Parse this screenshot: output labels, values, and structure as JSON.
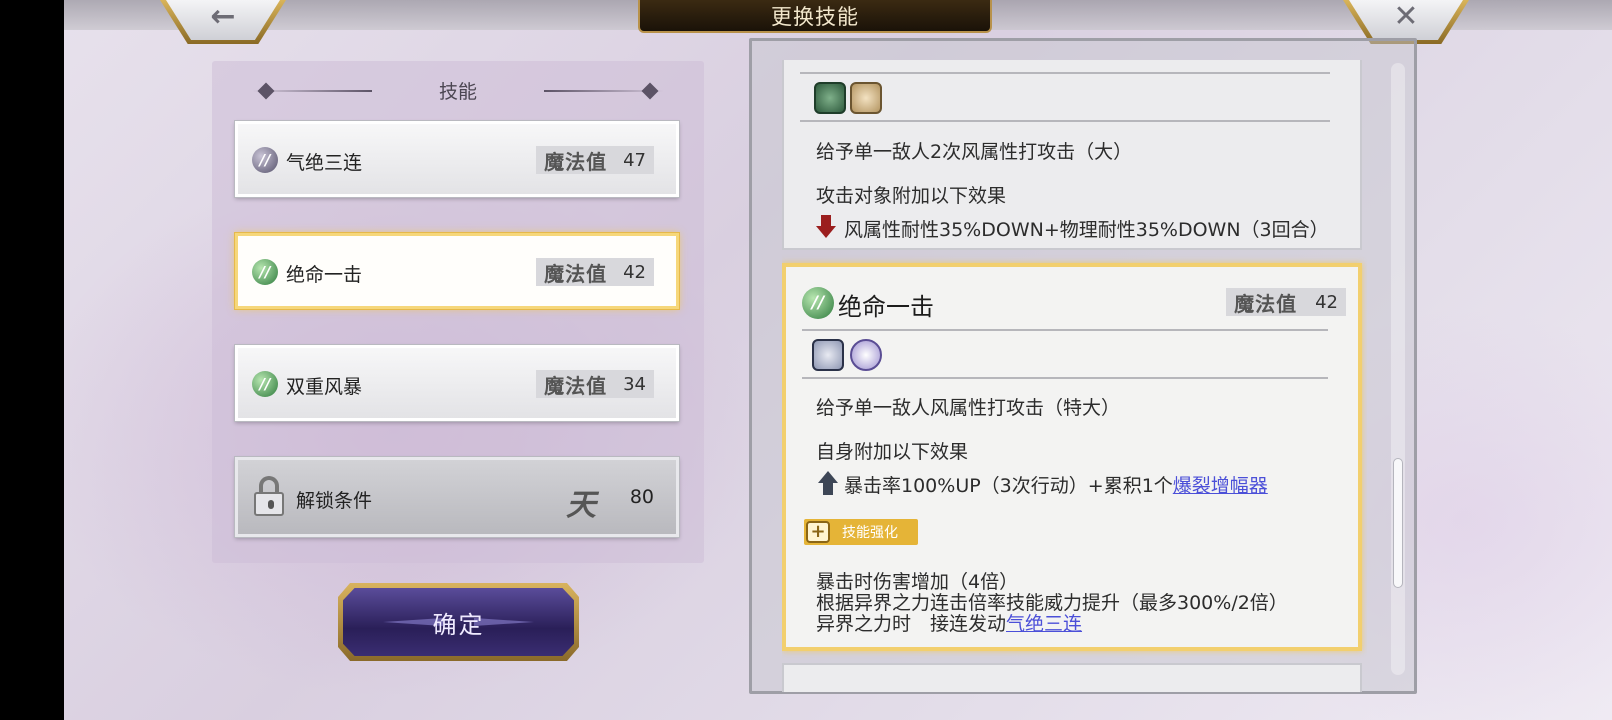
{
  "header": {
    "title": "更换技能",
    "back_icon": "←",
    "close_icon": "✕"
  },
  "skill_list": {
    "heading": "技能",
    "items": [
      {
        "name": "气绝三连",
        "mp_label": "魔法值",
        "mp_value": "47",
        "icon": "skill-icon-purple"
      },
      {
        "name": "绝命一击",
        "mp_label": "魔法值",
        "mp_value": "42",
        "icon": "skill-icon-green",
        "selected": true
      },
      {
        "name": "双重风暴",
        "mp_label": "魔法值",
        "mp_value": "34",
        "icon": "skill-icon-green"
      }
    ],
    "locked": {
      "name": "解锁条件",
      "icon": "lock-icon",
      "cond_symbol": "天",
      "cond_value": "80"
    }
  },
  "confirm_button": "确定",
  "details": {
    "partial_card": {
      "line1": "给予单一敌人2次风属性打攻击（大）",
      "line2": "攻击对象附加以下效果",
      "line3": "风属性耐性35%DOWN+物理耐性35%DOWN（3回合）"
    },
    "selected_card": {
      "title": "绝命一击",
      "mp_label": "魔法值",
      "mp_value": "42",
      "line1": "给予单一敌人风属性打攻击（特大）",
      "line2": "自身附加以下效果",
      "line3_prefix": "暴击率100%UP（3次行动）+累积1个",
      "line3_link": "爆裂增幅器",
      "enhance_label": "技能强化",
      "enh1": "暴击时伤害增加（4倍）",
      "enh2": "根据异界之力连击倍率技能威力提升（最多300%/2倍）",
      "enh3_prefix": "异界之力时　接连发动",
      "enh3_link": "气绝三连"
    }
  },
  "scrollbar": {
    "position": 0.82
  },
  "colors": {
    "gold": "#f2cf6e",
    "link": "#4b4fd8",
    "debuff": "#9b1e1e",
    "buff": "#3d4656"
  }
}
